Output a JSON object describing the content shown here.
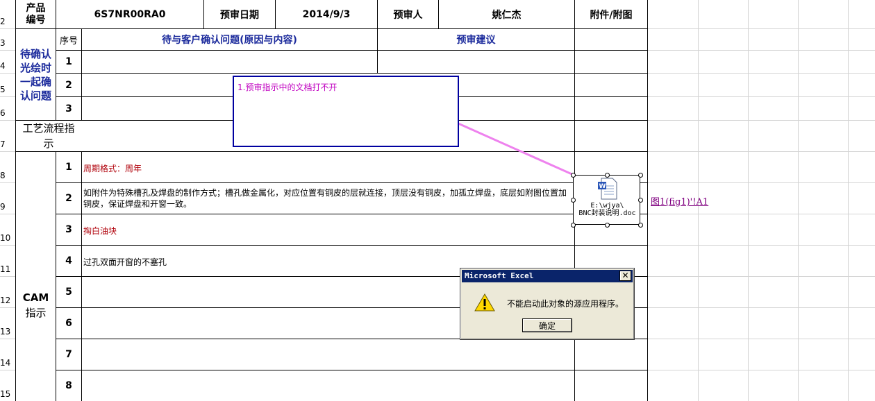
{
  "header": {
    "product_no_label": "产品编号",
    "product_no": "6S7NR00RA0",
    "review_date_label": "预审日期",
    "review_date": "2014/9/3",
    "reviewer_label": "预审人",
    "reviewer": "姚仁杰",
    "attachment_label": "附件/附图"
  },
  "columns": {
    "seq": "序号",
    "issues": "待与客户确认问题(原因与内容)",
    "suggestion": "预审建议"
  },
  "sections": {
    "pending_label": "待确认光绘时一起确认问题",
    "process_label": "工艺流程指示",
    "cam_label_line1": "CAM",
    "cam_label_line2": "指示"
  },
  "row_numbers": [
    "2",
    "3",
    "4",
    "5",
    "6",
    "7",
    "8",
    "9",
    "10",
    "11",
    "12",
    "13",
    "14",
    "15"
  ],
  "pending_rows": [
    "1",
    "2",
    "3"
  ],
  "cam_rows": [
    {
      "no": "1",
      "text": "周期格式：周年"
    },
    {
      "no": "2",
      "text": "如附件为特殊槽孔及焊盘的制作方式；槽孔做金属化，对应位置有铜皮的层就连接，顶层没有铜皮，加孤立焊盘，底层如附图位置加铜皮，保证焊盘和开窗一致。"
    },
    {
      "no": "3",
      "text": "掏白油块"
    },
    {
      "no": "4",
      "text": "过孔双面开窗的不塞孔"
    },
    {
      "no": "5",
      "text": ""
    },
    {
      "no": "6",
      "text": ""
    },
    {
      "no": "7",
      "text": ""
    },
    {
      "no": "8",
      "text": ""
    }
  ],
  "comment": {
    "text": "1.预审指示中的文档打不开"
  },
  "embedded_object": {
    "path_line1": "E:\\wjya\\",
    "path_line2": "BNC封装说明.doc",
    "hyperlink": "图1(fig1)'!A1"
  },
  "dialog": {
    "title": "Microsoft Excel",
    "message": "不能启动此对象的源应用程序。",
    "ok_label": "确定"
  },
  "colors": {
    "grid": "#d4d4d4",
    "border": "#000000",
    "header_blue": "#1b2a9c",
    "note_red": "#b0000a",
    "comment_text": "#c000c0",
    "comment_border": "#0000a0",
    "connector": "#ee82ee",
    "dialog_title_bg": "#0a246a",
    "dialog_bg": "#ece9d8",
    "hyperlink": "#800080"
  }
}
